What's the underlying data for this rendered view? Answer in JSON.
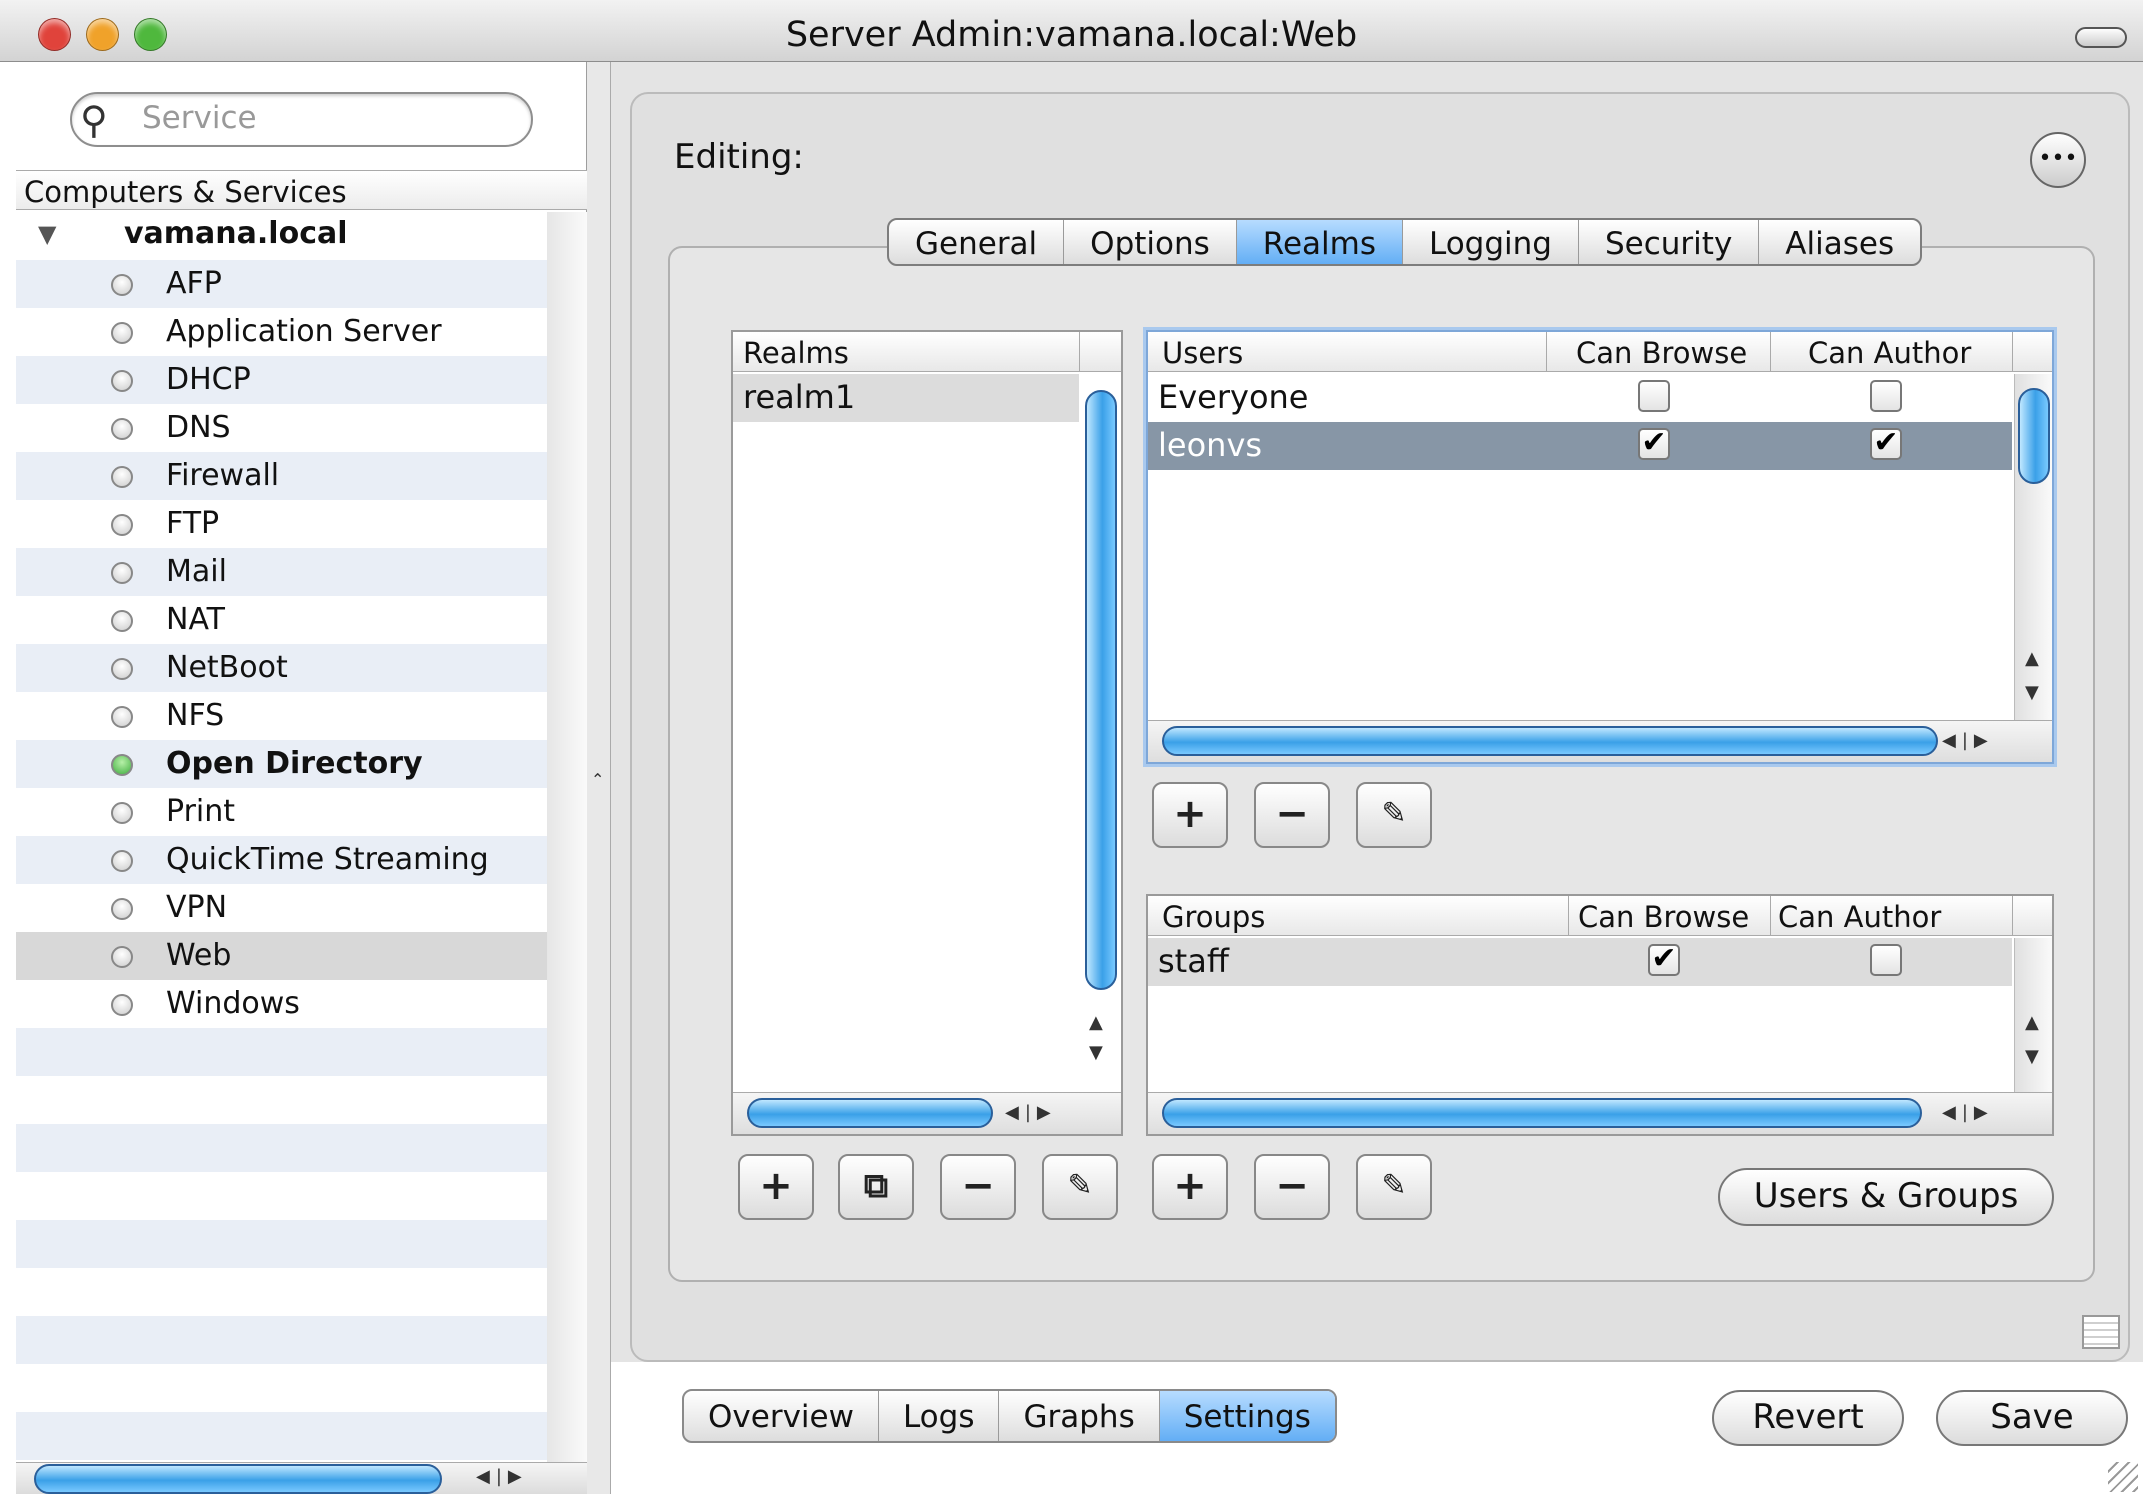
{
  "window": {
    "title": "Server Admin:vamana.local:Web"
  },
  "sidebar": {
    "search_placeholder": "Service",
    "header": "Computers & Services",
    "host": "vamana.local",
    "services": [
      {
        "label": "AFP",
        "status": "off"
      },
      {
        "label": "Application Server",
        "status": "off"
      },
      {
        "label": "DHCP",
        "status": "off"
      },
      {
        "label": "DNS",
        "status": "off"
      },
      {
        "label": "Firewall",
        "status": "off"
      },
      {
        "label": "FTP",
        "status": "off"
      },
      {
        "label": "Mail",
        "status": "off"
      },
      {
        "label": "NAT",
        "status": "off"
      },
      {
        "label": "NetBoot",
        "status": "off"
      },
      {
        "label": "NFS",
        "status": "off"
      },
      {
        "label": "Open Directory",
        "status": "running"
      },
      {
        "label": "Print",
        "status": "off"
      },
      {
        "label": "QuickTime Streaming",
        "status": "off"
      },
      {
        "label": "VPN",
        "status": "off"
      },
      {
        "label": "Web",
        "status": "off",
        "selected": true
      },
      {
        "label": "Windows",
        "status": "off"
      }
    ]
  },
  "main": {
    "editing_label": "Editing:",
    "tabs": [
      {
        "label": "General"
      },
      {
        "label": "Options"
      },
      {
        "label": "Realms",
        "selected": true
      },
      {
        "label": "Logging"
      },
      {
        "label": "Security"
      },
      {
        "label": "Aliases"
      }
    ],
    "realms": {
      "header": "Realms",
      "rows": [
        "realm1"
      ]
    },
    "users": {
      "headers": [
        "Users",
        "Can Browse",
        "Can Author"
      ],
      "rows": [
        {
          "name": "Everyone",
          "browse": false,
          "author": false
        },
        {
          "name": "leonvs",
          "browse": true,
          "author": true,
          "selected": true
        }
      ]
    },
    "groups": {
      "headers": [
        "Groups",
        "Can Browse",
        "Can Author"
      ],
      "rows": [
        {
          "name": "staff",
          "browse": true,
          "author": false
        }
      ]
    },
    "users_groups_button": "Users & Groups"
  },
  "bottom": {
    "tabs": [
      {
        "label": "Overview"
      },
      {
        "label": "Logs"
      },
      {
        "label": "Graphs"
      },
      {
        "label": "Settings",
        "selected": true
      }
    ],
    "revert": "Revert",
    "save": "Save"
  },
  "icons": {
    "plus": "+",
    "minus": "−",
    "edit": "✎",
    "duplicate": "⧉",
    "check": "✔"
  },
  "colors": {
    "selection_blue": "#63aef5",
    "row_selected": "#8796a6",
    "status_running": "#3fae3f",
    "scroll_blue": "#3aa0e8"
  }
}
